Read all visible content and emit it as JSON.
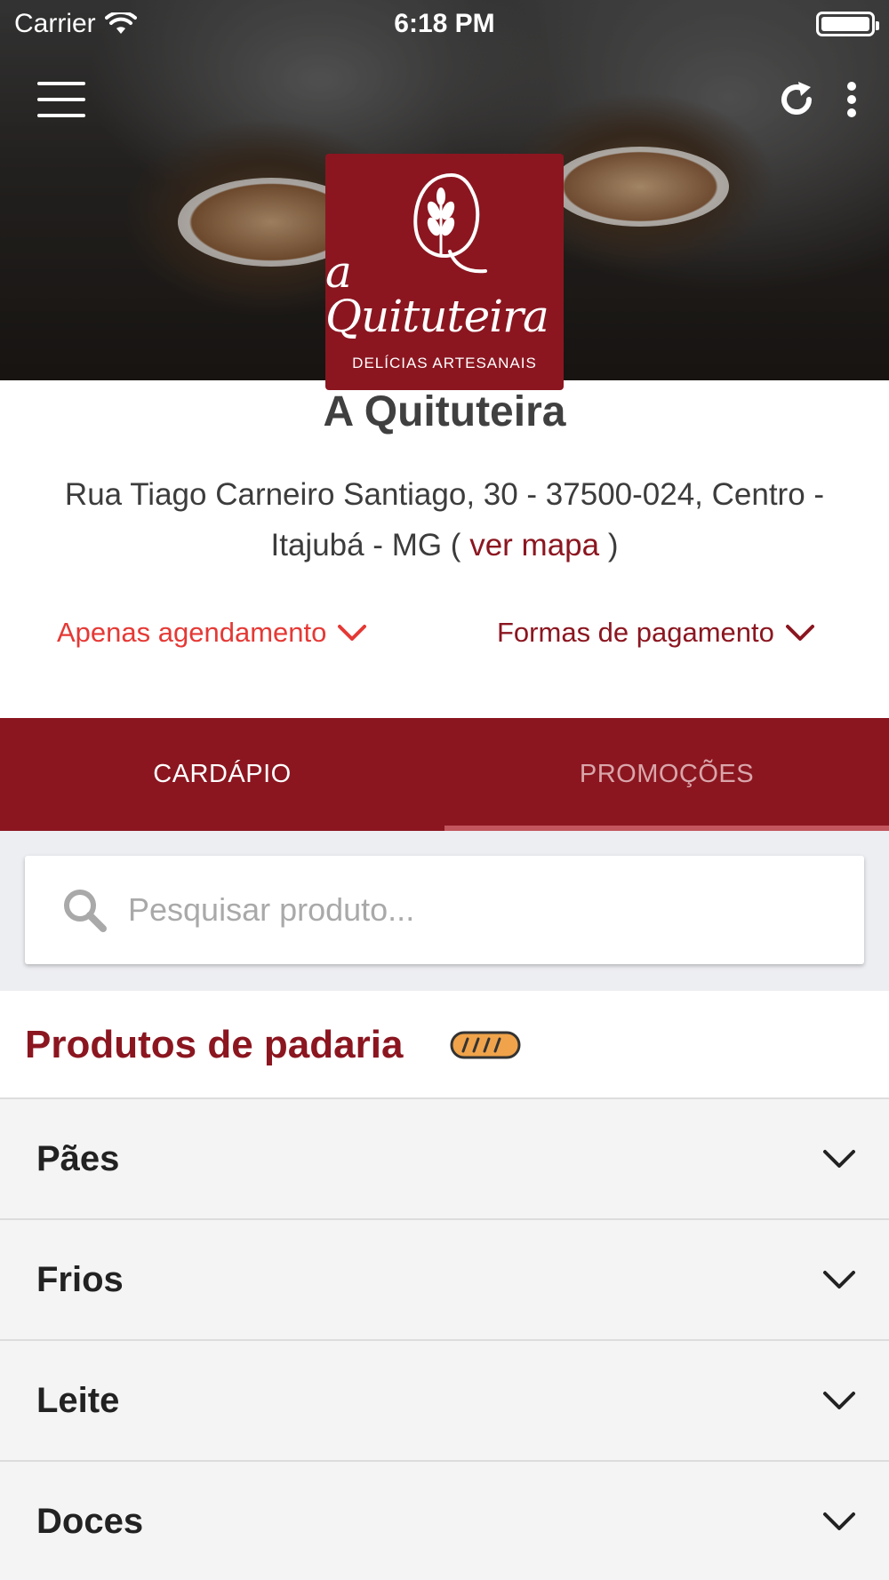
{
  "status_bar": {
    "carrier": "Carrier",
    "time": "6:18 PM"
  },
  "header": {
    "menu_icon": "hamburger-menu-icon",
    "refresh_icon": "refresh-icon",
    "more_icon": "more-vertical-icon"
  },
  "logo": {
    "name": "a Quituteira",
    "tagline": "DELÍCIAS ARTESANAIS"
  },
  "store": {
    "name": "A Quituteira",
    "address_line": "Rua Tiago Carneiro Santiago, 30 - 37500-024, Centro - Itajubá - MG (",
    "map_link": "ver mapa",
    "address_close": ")"
  },
  "options": {
    "schedule_label": "Apenas agendamento",
    "payment_label": "Formas de pagamento"
  },
  "tabs": [
    {
      "label": "CARDÁPIO",
      "active": true
    },
    {
      "label": "PROMOÇÕES",
      "active": false
    }
  ],
  "search": {
    "placeholder": "Pesquisar produto...",
    "value": ""
  },
  "section": {
    "title": "Produtos de padaria",
    "icon": "bread-icon"
  },
  "categories": [
    {
      "label": "Pães"
    },
    {
      "label": "Frios"
    },
    {
      "label": "Leite"
    },
    {
      "label": "Doces"
    }
  ],
  "colors": {
    "brand": "#8b1620",
    "schedule_accent": "#e53935",
    "list_bg": "#f4f4f4",
    "search_bg": "#edeef2"
  }
}
